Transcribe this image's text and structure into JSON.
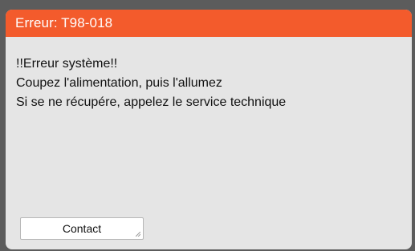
{
  "dialog": {
    "title": "Erreur: T98-018",
    "message_lines": [
      "!!Erreur système!!",
      "Coupez l'alimentation, puis l'allumez",
      "Si se ne récupére, appelez le service technique"
    ],
    "contact_label": "Contact"
  },
  "colors": {
    "title_bar": "#f35b2c",
    "dialog_bg": "#e5e5e5",
    "screen_bg": "#5c5c5c"
  }
}
